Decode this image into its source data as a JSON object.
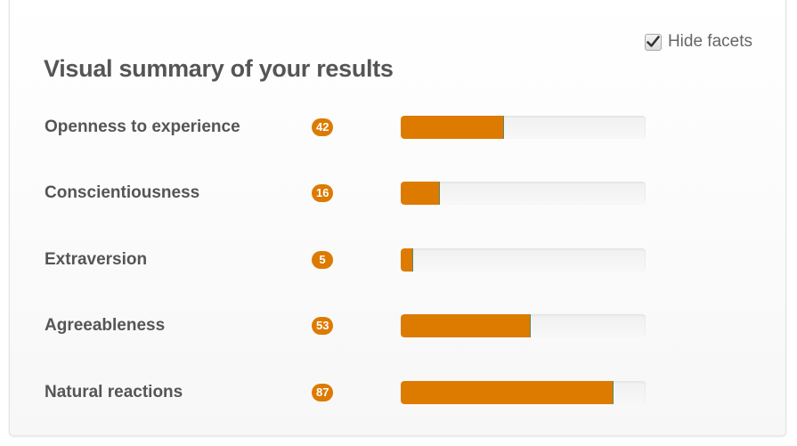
{
  "hide_facets": {
    "label": "Hide facets",
    "checked": true
  },
  "title": "Visual summary of your results",
  "colors": {
    "accent": "#dd7a00",
    "text": "#555555",
    "track": "#f3f3f3"
  },
  "traits": [
    {
      "label": "Openness to experience",
      "score": "42",
      "percent": 42
    },
    {
      "label": "Conscientiousness",
      "score": "16",
      "percent": 16
    },
    {
      "label": "Extraversion",
      "score": "5",
      "percent": 5
    },
    {
      "label": "Agreeableness",
      "score": "53",
      "percent": 53
    },
    {
      "label": "Natural reactions",
      "score": "87",
      "percent": 87
    }
  ]
}
